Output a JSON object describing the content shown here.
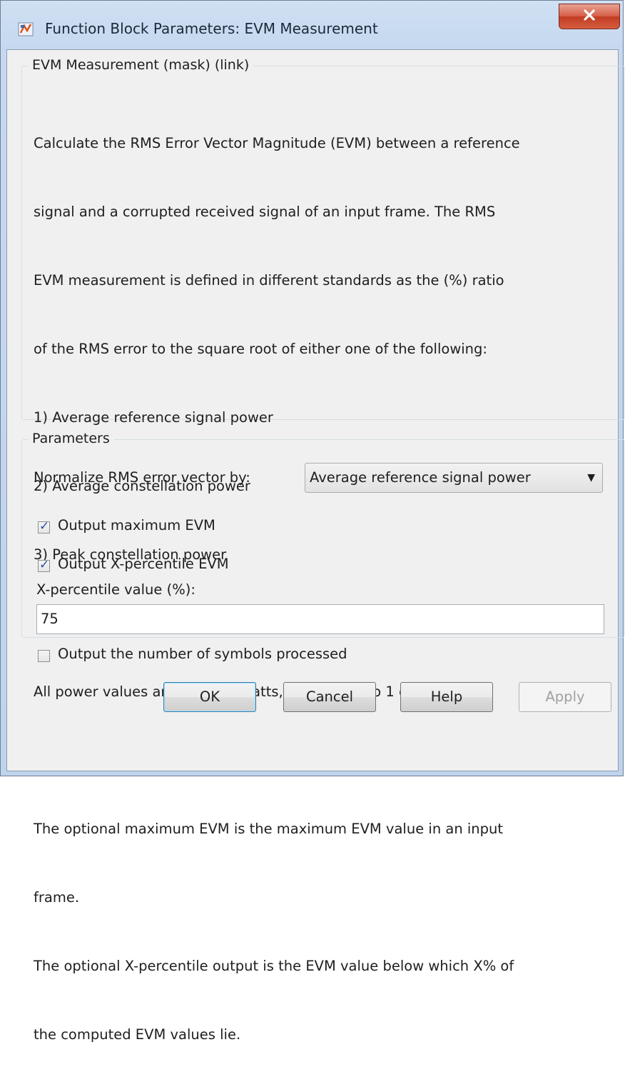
{
  "window": {
    "title": "Function Block Parameters: EVM Measurement"
  },
  "description_group": {
    "legend": "EVM Measurement (mask) (link)",
    "lines": [
      "Calculate the RMS Error Vector Magnitude (EVM) between a reference",
      "signal and a corrupted received signal of an input frame. The RMS",
      "EVM measurement is defined in different standards as the (%) ratio",
      "of the RMS error to the square root of either one of the following:",
      "1) Average reference signal power",
      "2) Average constellation power",
      "3) Peak constellation power",
      "",
      "All power values are given in Watts, referenced to 1 ohm.",
      "",
      "The optional maximum EVM is the maximum EVM value in an input",
      "frame.",
      "The optional X-percentile output is the EVM value below which X% of",
      "the computed EVM values lie."
    ]
  },
  "parameters": {
    "legend": "Parameters",
    "normalize_label": "Normalize RMS error vector by:",
    "normalize_value": "Average reference signal power",
    "output_max_evm": {
      "label": "Output maximum EVM",
      "checked": true
    },
    "output_xpct_evm": {
      "label": "Output X-percentile EVM",
      "checked": true
    },
    "xpct_label": "X-percentile value (%):",
    "xpct_value": "75",
    "output_symbols": {
      "label": "Output the number of symbols processed",
      "checked": false
    }
  },
  "buttons": {
    "ok": "OK",
    "cancel": "Cancel",
    "help": "Help",
    "apply": "Apply"
  },
  "icons": {
    "app": "simulink-block-icon",
    "close": "close-icon",
    "dropdown": "chevron-down-icon",
    "check": "check-icon"
  }
}
